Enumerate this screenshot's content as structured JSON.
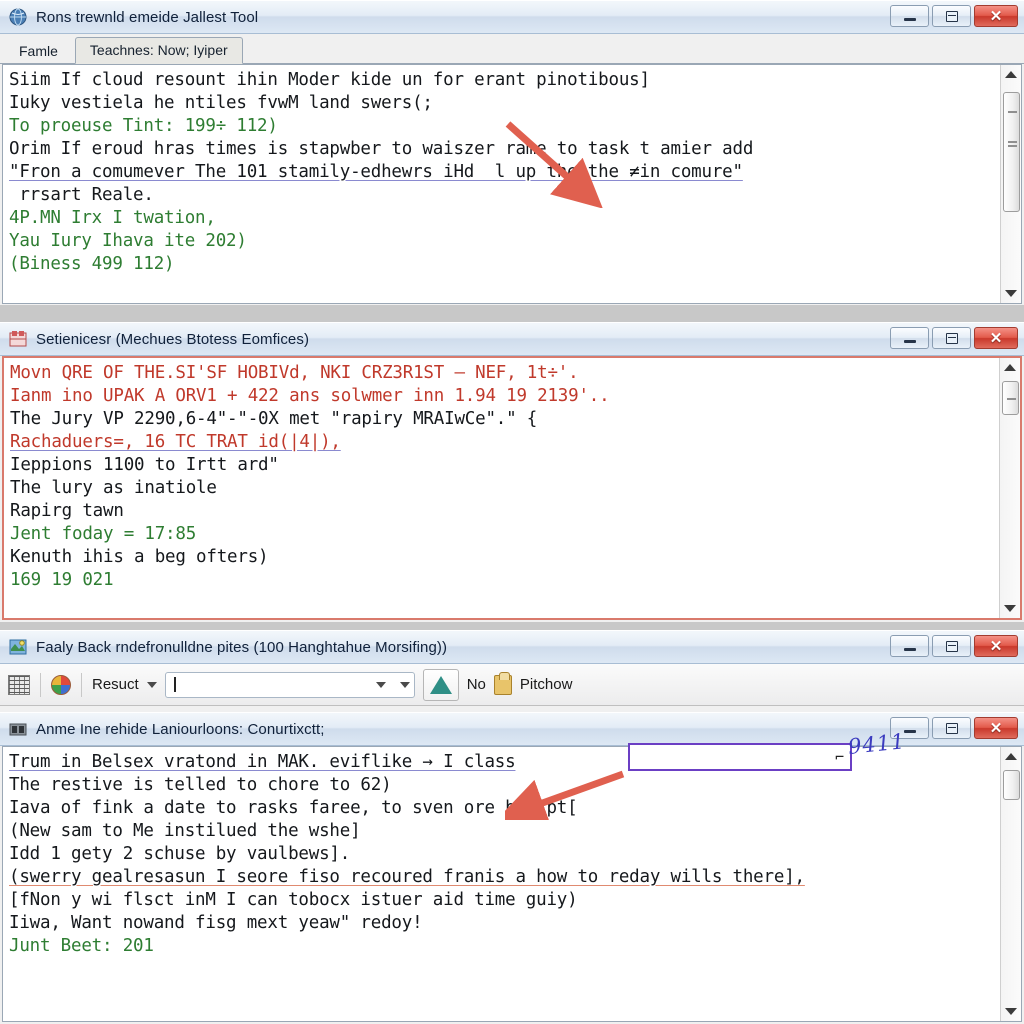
{
  "windows": [
    {
      "id": "win-1",
      "title": "Rons trewnld emeide Jallest Tool",
      "icon": "app-globe-icon",
      "buttons": {
        "minimize": "minimize",
        "restore": "restore",
        "close": "close"
      },
      "tabs": [
        {
          "label": "Famle",
          "selected": false
        },
        {
          "label": "Teachnes: Now; Iyiper",
          "selected": true
        }
      ],
      "lines": [
        {
          "text": "Siim If cloud resount ihin Moder kide un for erant pinotibous]",
          "color": "black"
        },
        {
          "text": "Iuky vestiela he ntiles fvwM land swers(;",
          "color": "black"
        },
        {
          "text": "To proeuse Tint: 199÷ 112)",
          "color": "green"
        },
        {
          "text": "",
          "color": "black"
        },
        {
          "text": "Orim If eroud hras times is stapwber to waiszer rame to task t amier add",
          "color": "black"
        },
        {
          "text": "\"Fron a comumever The 101 stamily-edhewrs iHd  l up the the ≠in comure\"",
          "color": "black"
        },
        {
          "text": " rrsart Reale.",
          "color": "black"
        },
        {
          "text": "4P.MN Irx I twation,",
          "color": "green"
        },
        {
          "text": "Yau Iury Ihava ite 202)",
          "color": "green"
        },
        {
          "text": "(Biness 499 112)",
          "color": "green"
        }
      ]
    },
    {
      "id": "win-2",
      "title": "Setienicesr (Mechues Btotess Eomfices)",
      "icon": "app-red-box-icon",
      "buttons": {
        "minimize": "minimize",
        "restore": "restore",
        "close": "close"
      },
      "lines": [
        {
          "text": "Movn QRE OF THE.SI'SF HOBIVd, NKI CRZ3R1ST — NEF, 1t÷'.",
          "color": "mixed"
        },
        {
          "text": "Ianm ino UPAK A ORV1 + 422 ans solwmer inn 1.94 19 2139'..",
          "color": "mixed"
        },
        {
          "text": "The Jury VP 2290,6-4\"-\"-0X met \"rapiry MRAIwCe\".\" {",
          "color": "mixed"
        },
        {
          "text": "Rachaduers=, 16 TC TRAT id(|4|),",
          "color": "mixed"
        },
        {
          "text": "Ieppions 1100 to Irtt ard\"",
          "color": "black"
        },
        {
          "text": "The lury as inatiole",
          "color": "black"
        },
        {
          "text": "Rapirg tawn",
          "color": "black"
        },
        {
          "text": "Jent foday = 17:85",
          "color": "green"
        },
        {
          "text": "",
          "color": "black"
        },
        {
          "text": "Kenuth ihis a beg ofters)",
          "color": "black"
        },
        {
          "text": "169 19 021",
          "color": "green"
        }
      ]
    },
    {
      "id": "win-3",
      "title": "Faaly Back rndefronulldne pites (100 Hanghtahue Morsifing))",
      "icon": "app-map-icon",
      "buttons": {
        "minimize": "minimize",
        "restore": "restore",
        "close": "close"
      },
      "toolbar": {
        "grid_icon": "grid-icon",
        "wheel_icon": "color-wheel-icon",
        "result_label": "Resuct",
        "result_caret": "chevron-down-icon",
        "combo_value": "",
        "combo_caret_1": "chevron-down-icon",
        "combo_caret_2": "chevron-down-icon",
        "triangle_icon": "green-triangle-icon",
        "no_label": "No",
        "clip_icon": "clipboard-icon",
        "pitchow_label": "Pitchow"
      }
    },
    {
      "id": "win-4",
      "title": "Anme Ine rehide Laniourloons: Conurtixctt;",
      "icon": "app-dark-icon",
      "buttons": {
        "minimize": "minimize",
        "restore": "restore",
        "close": "close"
      },
      "annotation": {
        "handwritten_value": "9411",
        "input_value": "",
        "input_cursor": "⌐"
      },
      "lines": [
        {
          "text": "Trum in Belsex vratond in MAK. eviflike → I class",
          "color": "black"
        },
        {
          "text": "The restive is telled to chore to 62)",
          "color": "black"
        },
        {
          "text": "Iava of fink a date to rasks faree, to sven ore braipt[",
          "color": "black"
        },
        {
          "text": "(New sam to Me instilued the wshe]",
          "color": "black"
        },
        {
          "text": "Idd 1 gety 2 schuse by vaulbews].",
          "color": "black"
        },
        {
          "text": "",
          "color": "black"
        },
        {
          "text": "(swerry gealresasun I seore fiso recoured franis a how to reday wills there],",
          "color": "black"
        },
        {
          "text": "[fNon y wi flsct inM I can tobocx istuer aid time guiy)",
          "color": "black"
        },
        {
          "text": "",
          "color": "black"
        },
        {
          "text": "Iiwa, Want nowand fisg mext yeaw\" redoy!",
          "color": "black"
        },
        {
          "text": "Junt Beet: 201",
          "color": "green"
        }
      ]
    }
  ],
  "colors": {
    "accent_red": "#d9534f",
    "arrow_red": "#e0604f",
    "annotation_purple": "#6b3fc4",
    "handwriting_blue": "#3b3bbf",
    "code_green": "#2e7d32",
    "code_blue": "#2b3fa0",
    "title_blue": "#10213a"
  }
}
